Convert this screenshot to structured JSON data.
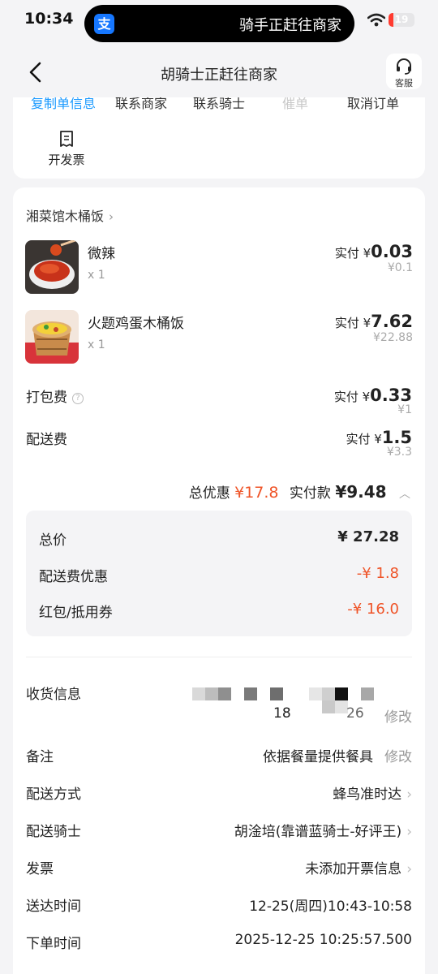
{
  "status_bar": {
    "time": "10:34",
    "island_text": "骑手正赶往商家",
    "battery": "19",
    "battery_fraction": 0.19
  },
  "nav": {
    "title": "胡骑士正赶往商家",
    "service_label": "客服"
  },
  "order_actions": [
    "复制单信息",
    "联系商家",
    "联系骑士",
    "催单",
    "取消订单"
  ],
  "invoice_action": {
    "label": "开发票",
    "icon": "receipt-icon"
  },
  "shop": {
    "name": "湘菜馆木桶饭"
  },
  "items": [
    {
      "name": "微辣",
      "qty": "x 1",
      "paid_prefix": "实付 ¥",
      "paid": "0.03",
      "original": "¥0.1"
    },
    {
      "name": "火题鸡蛋木桶饭",
      "qty": "x 1",
      "paid_prefix": "实付 ¥",
      "paid": "7.62",
      "original": "¥22.88"
    }
  ],
  "fees": [
    {
      "name": "打包费",
      "paid_prefix": "实付 ¥",
      "paid": "0.33",
      "original": "¥1"
    },
    {
      "name": "配送费",
      "paid_prefix": "实付 ¥",
      "paid": "1.5",
      "original": "¥3.3"
    }
  ],
  "summary": {
    "discount_label": "总优惠",
    "discount": "¥17.8",
    "paid_label": "实付款",
    "paid": "¥9.48"
  },
  "breakdown": [
    {
      "label": "总价",
      "value": "¥ 27.28"
    },
    {
      "label": "配送费优惠",
      "value": "-¥ 1.8"
    },
    {
      "label": "红包/抵用券",
      "value": "-¥ 16.0"
    }
  ],
  "delivery_info": {
    "label": "收货信息",
    "partial_number": "18",
    "partial_suffix": "26",
    "edit": "修改"
  },
  "details": [
    {
      "label": "备注",
      "value": "依据餐量提供餐具",
      "edit": "修改"
    },
    {
      "label": "配送方式",
      "value": "蜂鸟准时达"
    },
    {
      "label": "配送骑士",
      "value": "胡淦培(靠谱蓝骑士-好评王)"
    },
    {
      "label": "发票",
      "value": "未添加开票信息"
    },
    {
      "label": "送达时间",
      "value": "12-25(周四)10:43-10:58"
    },
    {
      "label": "下单时间",
      "value": "2025-12-25 10:25:57.500"
    }
  ],
  "colors": {
    "accent_red": "#ef5428",
    "link_blue": "#1b9aff",
    "background": "#f4f4f6"
  }
}
